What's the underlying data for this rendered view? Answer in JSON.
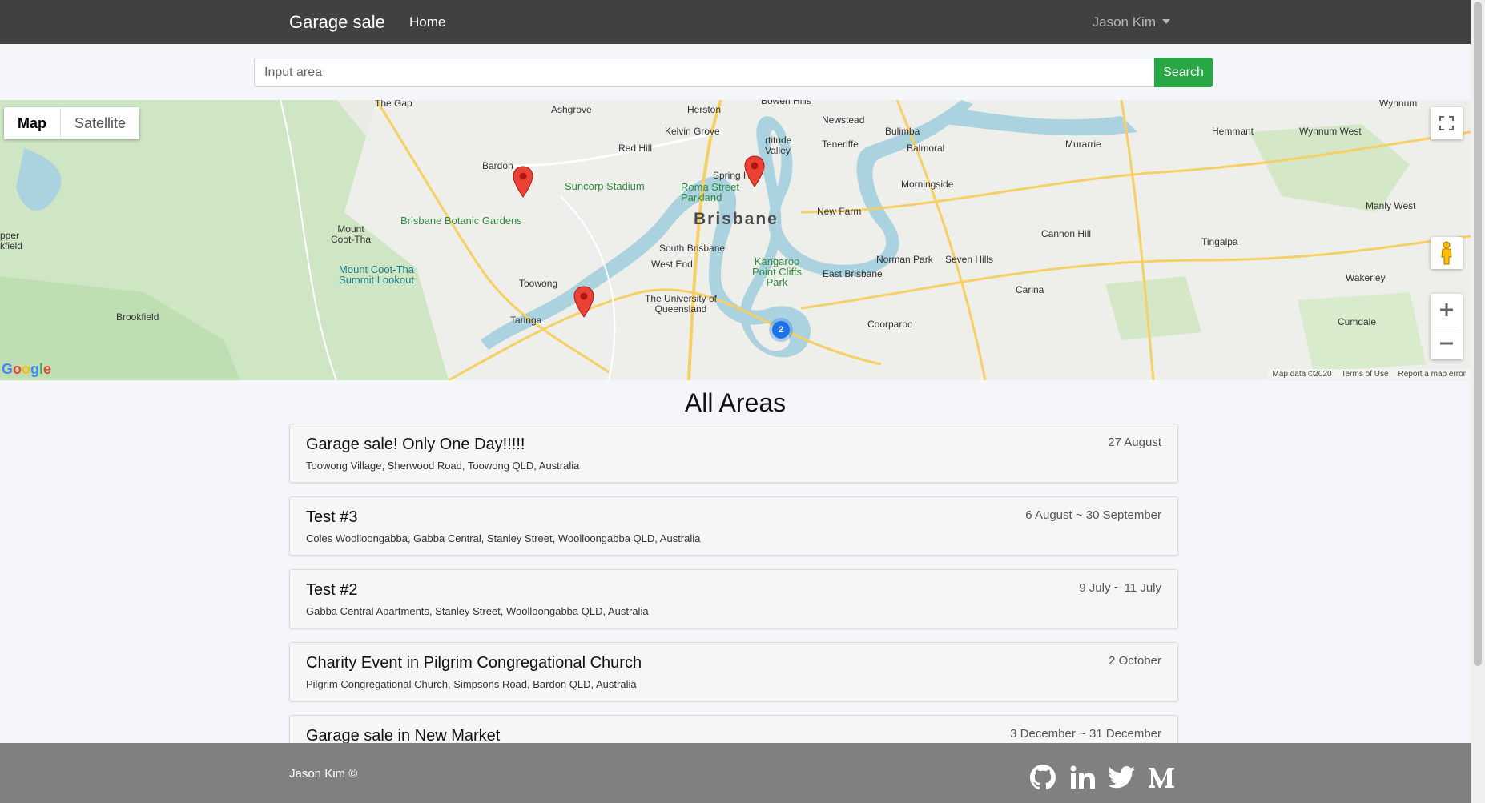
{
  "navbar": {
    "brand": "Garage sale",
    "home": "Home",
    "user": "Jason Kim"
  },
  "search": {
    "placeholder": "Input area",
    "button": "Search"
  },
  "map": {
    "type_map": "Map",
    "type_satellite": "Satellite",
    "cluster_count": "2",
    "google": "Google",
    "footer": {
      "data": "Map data ©2020",
      "terms": "Terms of Use",
      "report": "Report a map error"
    },
    "labels": {
      "brisbane": "Brisbane",
      "the_gap": "The Gap",
      "ashgrove": "Ashgrove",
      "herston": "Herston",
      "bowen_hills": "Bowen Hills",
      "newstead": "Newstead",
      "bulimba": "Bulimba",
      "hemmant": "Hemmant",
      "wynnum_west": "Wynnum West",
      "wynnum": "Wynnum",
      "kelvin_grove": "Kelvin Grove",
      "red_hill": "Red Hill",
      "fortitude_valley": "rtitude Valley",
      "teneriffe": "Teneriffe",
      "balmoral": "Balmoral",
      "murarrie": "Murarrie",
      "bardon": "Bardon",
      "spring_hill": "Spring Hill",
      "suncorp": "Suncorp Stadium",
      "roma_street": "Roma Street Parkland",
      "morningside": "Morningside",
      "mount_coot_tha": "Mount Coot-Tha",
      "botanic": "Brisbane Botanic Gardens",
      "new_farm": "New Farm",
      "manly_west": "Manly West",
      "cannon_hill": "Cannon Hill",
      "tingalpa": "Tingalpa",
      "south_brisbane": "South Brisbane",
      "kangaroo_point": "Kangaroo Point Cliffs Park",
      "west_end": "West End",
      "norman_park": "Norman Park",
      "seven_hills": "Seven Hills",
      "east_brisbane": "East Brisbane",
      "toowong": "Toowong",
      "summit": "Mount Coot-Tha Summit Lookout",
      "uq": "The University of Queensland",
      "carina": "Carina",
      "wakerley": "Wakerley",
      "brookfield": "Brookfield",
      "taringa": "Taringa",
      "coorparoo": "Coorparoo",
      "cumdale": "Cumdale",
      "upper_kenmore": "pper kfield"
    }
  },
  "section_title": "All Areas",
  "listings": [
    {
      "title": "Garage sale! Only One Day!!!!!",
      "date": "27 August",
      "address": "Toowong Village, Sherwood Road, Toowong QLD, Australia"
    },
    {
      "title": "Test #3",
      "date": "6 August ~ 30 September",
      "address": "Coles Woolloongabba, Gabba Central, Stanley Street, Woolloongabba QLD, Australia"
    },
    {
      "title": "Test #2",
      "date": "9 July ~ 11 July",
      "address": "Gabba Central Apartments, Stanley Street, Woolloongabba QLD, Australia"
    },
    {
      "title": "Charity Event in Pilgrim Congregational Church",
      "date": "2 October",
      "address": "Pilgrim Congregational Church, Simpsons Road, Bardon QLD, Australia"
    },
    {
      "title": "Garage sale in New Market",
      "date": "3 December ~ 31 December",
      "address": ""
    }
  ],
  "footer": {
    "copyright": "Jason Kim ©",
    "social": [
      "github-icon",
      "linkedin-icon",
      "twitter-icon",
      "medium-icon"
    ]
  },
  "colors": {
    "navbar": "#414141",
    "search_button": "#28a745",
    "footer": "#808080",
    "marker": "#ea4335",
    "cluster": "#1a73e8"
  }
}
